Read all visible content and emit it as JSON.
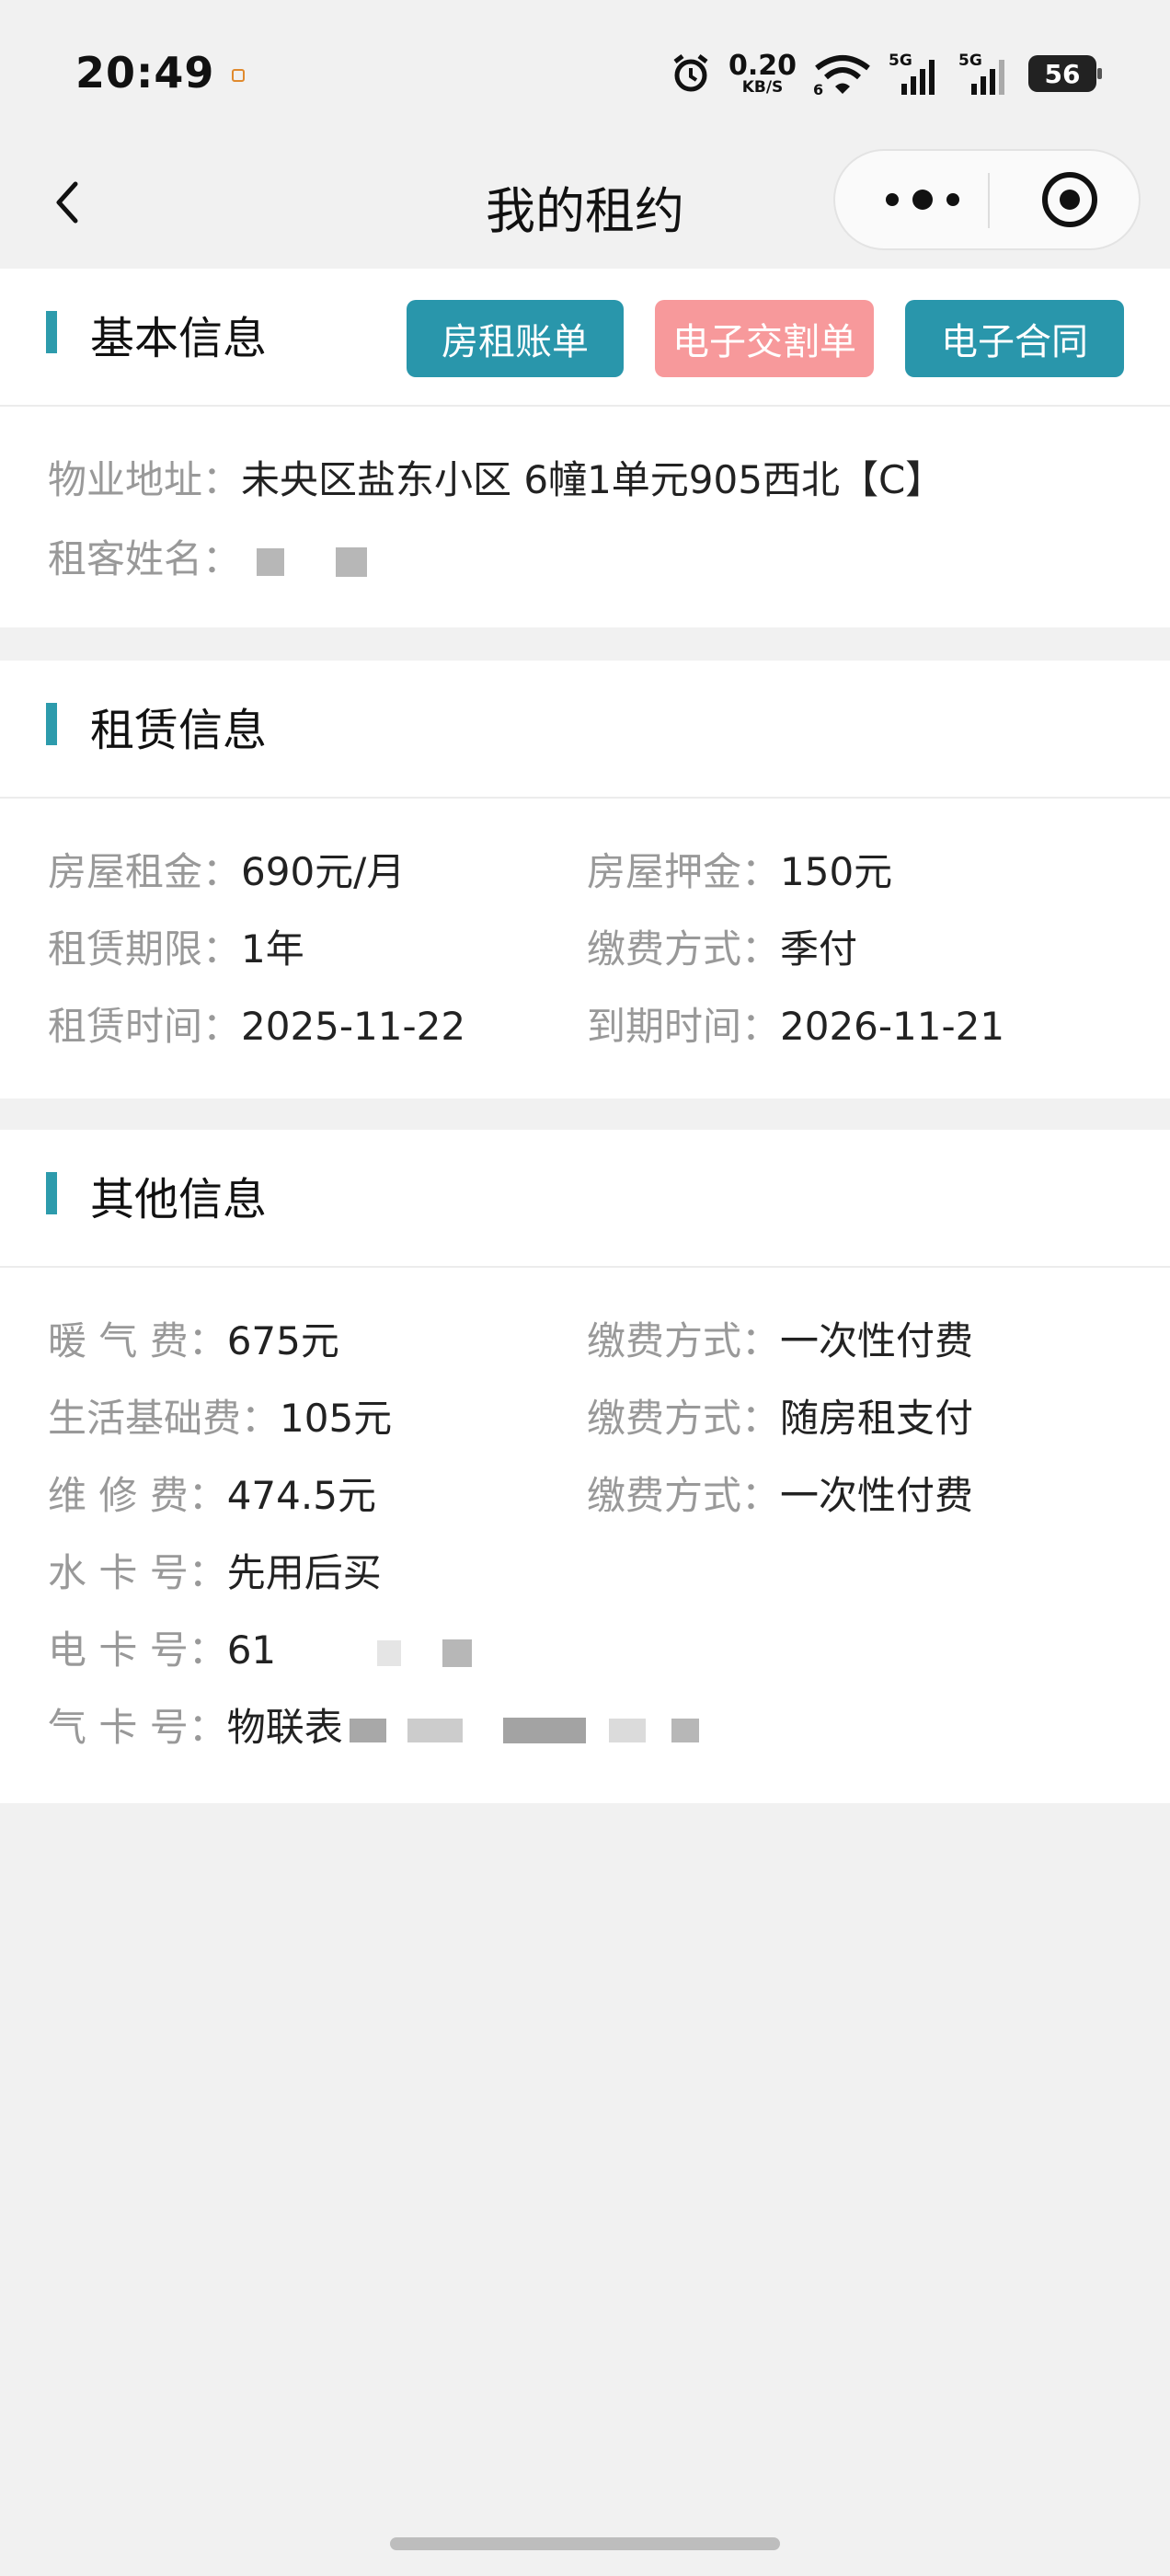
{
  "status": {
    "time": "20:49",
    "speed_value": "0.20",
    "speed_unit": "KB/S",
    "wifi_sub": "6",
    "net1": "5G",
    "net2": "5G",
    "battery": "56"
  },
  "nav": {
    "title": "我的租约"
  },
  "basic": {
    "title": "基本信息",
    "buttons": {
      "rent_bill": "房租账单",
      "handover": "电子交割单",
      "contract": "电子合同"
    },
    "address_label": "物业地址：",
    "address_value": "未央区盐东小区 6幢1单元905西北【C】",
    "tenant_label": "租客姓名："
  },
  "lease": {
    "title": "租赁信息",
    "rent_label": "房屋租金：",
    "rent_value": "690元/月",
    "deposit_label": "房屋押金：",
    "deposit_value": "150元",
    "term_label": "租赁期限：",
    "term_value": "1年",
    "pay_label": "缴费方式：",
    "pay_value": "季付",
    "start_label": "租赁时间：",
    "start_value": "2025-11-22",
    "end_label": "到期时间：",
    "end_value": "2026-11-21"
  },
  "other": {
    "title": "其他信息",
    "heating_label": "暖 气 费：",
    "heating_value": "675元",
    "heating_pay_label": "缴费方式：",
    "heating_pay_value": "一次性付费",
    "living_label": "生活基础费：",
    "living_value": "105元",
    "living_pay_label": "缴费方式：",
    "living_pay_value": "随房租支付",
    "repair_label": "维 修 费：",
    "repair_value": "474.5元",
    "repair_pay_label": "缴费方式：",
    "repair_pay_value": "一次性付费",
    "water_label": "水 卡 号：",
    "water_value": "先用后买",
    "elec_label": "电 卡 号：",
    "elec_value": "61",
    "gas_label": "气 卡 号：",
    "gas_value": "物联表"
  },
  "colors": {
    "accent": "#2996ab",
    "pink_button": "#f7999b",
    "label_gray": "#999999",
    "page_bg": "#f1f1f1"
  }
}
